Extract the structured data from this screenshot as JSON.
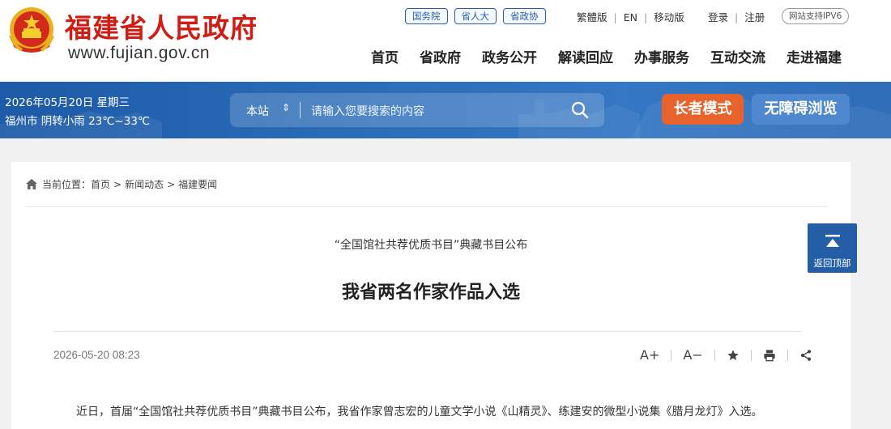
{
  "header": {
    "site_name": "福建省人民政府",
    "site_url": "www.fujian.gov.cn",
    "link_pills": [
      "国务院",
      "省人大",
      "省政协"
    ],
    "versions": [
      "繁體版",
      "EN",
      "移动版"
    ],
    "account": [
      "登录",
      "注册"
    ],
    "ipv6_badge": "网站支持IPV6",
    "nav": [
      "首页",
      "省政府",
      "政务公开",
      "解读回应",
      "办事服务",
      "互动交流",
      "走进福建"
    ]
  },
  "banner": {
    "date": "2026年05月20日 星期三",
    "weather": "福州市 阴转小雨 23℃~33℃",
    "search_scope": "本站",
    "search_placeholder": "请输入您要搜索的内容",
    "elder_mode": "长者模式",
    "accessible": "无障碍浏览"
  },
  "breadcrumb": {
    "prefix": "当前位置：",
    "items": [
      "首页",
      "新闻动态",
      "福建要闻"
    ],
    "separator": ">"
  },
  "article": {
    "subtitle": "“全国馆社共荐优质书目”典藏书目公布",
    "title": "我省两名作家作品入选",
    "date": "2026-05-20 08:23",
    "font_larger": "A+",
    "font_smaller": "A−",
    "body": "近日，首届“全国馆社共荐优质书目”典藏书目公布，我省作家曾志宏的儿童文学小说《山精灵》、练建安的微型小说集《腊月龙灯》入选。"
  },
  "back_to_top": "返回顶部",
  "colors": {
    "brand_red": "#d01d14",
    "banner_blue": "#2b6cb8",
    "elder_orange": "#e8632b",
    "access_blue": "#4f88cf",
    "back_top_blue": "#245ea7"
  },
  "icons": [
    "national-emblem-icon",
    "search-icon",
    "home-icon",
    "star-icon",
    "print-icon",
    "share-icon",
    "arrow-up-icon"
  ]
}
